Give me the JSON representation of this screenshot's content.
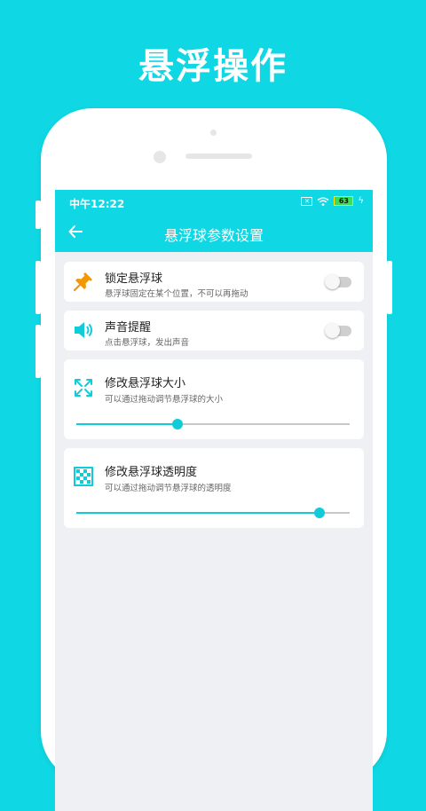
{
  "promo": {
    "headline": "悬浮操作"
  },
  "status_bar": {
    "time": "中午12:22",
    "battery_level": "63"
  },
  "app_bar": {
    "title": "悬浮球参数设置"
  },
  "settings": {
    "lock": {
      "title": "锁定悬浮球",
      "description": "悬浮球固定在某个位置，不可以再拖动",
      "enabled": false
    },
    "sound": {
      "title": "声音提醒",
      "description": "点击悬浮球，发出声音",
      "enabled": false
    },
    "size": {
      "title": "修改悬浮球大小",
      "description": "可以通过拖动调节悬浮球的大小",
      "value_fraction": 0.37
    },
    "opacity": {
      "title": "修改悬浮球透明度",
      "description": "可以通过拖动调节悬浮球的透明度",
      "value_fraction": 0.89
    }
  },
  "colors": {
    "accent": "#0fd7e3",
    "slider": "#12cbd8",
    "pin_icon": "#f39800",
    "screen_background": "#eef0f3"
  },
  "icons": {
    "lock": "pin-icon",
    "sound": "speaker-icon",
    "size": "expand-arrows-icon",
    "opacity": "checker-icon",
    "back": "arrow-left-icon"
  }
}
